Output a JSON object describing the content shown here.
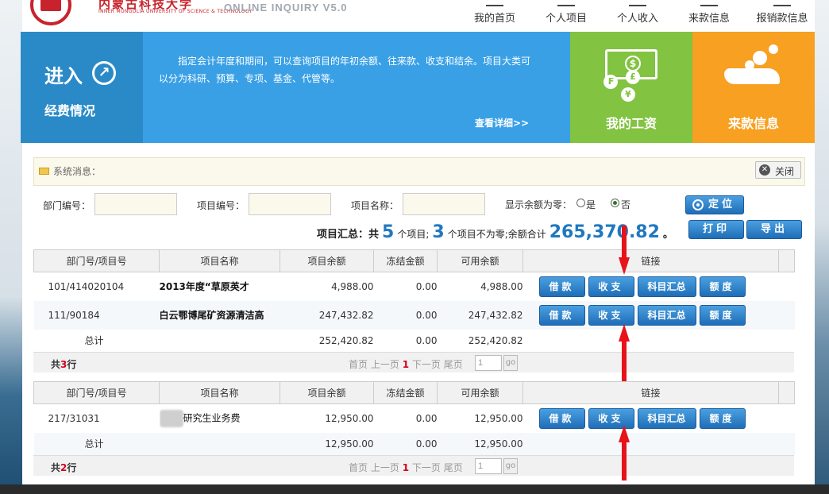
{
  "header": {
    "school_cn": "内蒙古科技大学",
    "school_en": "INNER MONGOLIA UNIVERSITY OF SCIENCE & TECHNOLOGY",
    "system_title": "ONLINE INQUIRY V5.0",
    "nav": [
      "我的首页",
      "个人项目",
      "个人收入",
      "来款信息",
      "报销款信息"
    ]
  },
  "banner": {
    "enter_label": "进入",
    "enter_sub": "经费情况",
    "desc": "指定会计年度和期间，可以查询项目的年初余额、往来款、收支和结余。项目大类可以分为科研、预算、专项、基金、代管等。",
    "more": "查看详细>>",
    "salary": "我的工资",
    "income": "来款信息",
    "colors": {
      "enter": "#2a8ac8",
      "desc": "#3aa0e6",
      "salary": "#82c341",
      "income": "#f7a021"
    }
  },
  "message": {
    "label": "系统消息：",
    "close": "关闭"
  },
  "filters": {
    "dept_label": "部门编号：",
    "proj_no_label": "项目编号：",
    "proj_name_label": "项目名称：",
    "zero_label": "显示余额为零：",
    "opt_yes": "是",
    "opt_no": "否",
    "selected": "否",
    "locate": "定位",
    "print": "打印",
    "export": "导出"
  },
  "summary": {
    "prefix": "项目汇总：共",
    "total_projects": "5",
    "mid1": "个项目;",
    "nonzero_projects": "3",
    "mid2": "个项目不为零;余额合计",
    "balance": "265,370.82",
    "suffix": "。"
  },
  "table_headers": [
    "部门号/项目号",
    "项目名称",
    "项目余额",
    "冻结金额",
    "可用余额",
    "链接"
  ],
  "link_buttons": [
    "借款",
    "收支",
    "科目汇总",
    "额度"
  ],
  "table1": {
    "rows": [
      {
        "code": "101/414020104",
        "name": "2013年度“草原英才",
        "balance": "4,988.00",
        "frozen": "0.00",
        "available": "4,988.00"
      },
      {
        "code": "111/90184",
        "name": "白云鄂博尾矿资源清洁高",
        "balance": "247,432.82",
        "frozen": "0.00",
        "available": "247,432.82"
      }
    ],
    "total": {
      "label": "总计",
      "balance": "252,420.82",
      "frozen": "0.00",
      "available": "252,420.82"
    },
    "pager": {
      "count_prefix": "共",
      "count": "3",
      "count_suffix": "行",
      "first": "首页",
      "prev": "上一页",
      "current": "1",
      "next": "下一页",
      "last": "尾页",
      "page_input": "1",
      "go": "go"
    }
  },
  "table2": {
    "rows": [
      {
        "code": "217/31031",
        "name": "研究生业务费",
        "balance": "12,950.00",
        "frozen": "0.00",
        "available": "12,950.00"
      }
    ],
    "total": {
      "label": "总计",
      "balance": "12,950.00",
      "frozen": "0.00",
      "available": "12,950.00"
    },
    "pager": {
      "count_prefix": "共",
      "count": "2",
      "count_suffix": "行",
      "first": "首页",
      "prev": "上一页",
      "current": "1",
      "next": "下一页",
      "last": "尾页",
      "page_input": "1",
      "go": "go"
    }
  }
}
